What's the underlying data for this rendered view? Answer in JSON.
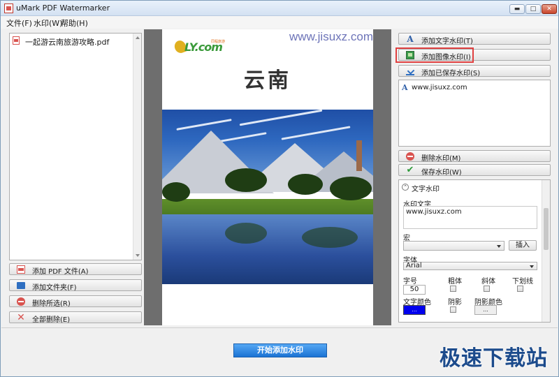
{
  "window": {
    "title": "uMark PDF Watermarker",
    "minimize": "▬",
    "restore": "□",
    "close": "✕"
  },
  "menu": [
    "文件(F)",
    "水印(W)",
    "帮助(H)"
  ],
  "left": {
    "files": [
      "一起游云南旅游攻略.pdf"
    ],
    "buttons": {
      "add_pdf": "添加 PDF 文件(A)",
      "add_folder": "添加文件夹(F)",
      "remove_selected": "删除所选(R)",
      "remove_all": "全部删除(E)"
    }
  },
  "preview": {
    "logo_text": "LY.com",
    "logo_sub": "同程旅游",
    "watermark_text": "www.jisuxz.com",
    "page_title": "云南"
  },
  "right": {
    "buttons": {
      "add_text": "添加文字水印(T)",
      "add_image": "添加图像水印(I)",
      "add_saved": "添加已保存水印(S)",
      "delete": "删除水印(M)",
      "save": "保存水印(W)"
    },
    "watermark_list": [
      "www.jisuxz.com"
    ],
    "props": {
      "section_title": "文字水印",
      "text_label": "水印文字",
      "text_value": "www.jisuxz.com",
      "macro_label": "宏",
      "macro_value": "",
      "insert_btn": "插入",
      "font_label": "字体",
      "font_value": "Arial",
      "size_label": "字号",
      "size_value": "50",
      "bold_label": "粗体",
      "italic_label": "斜体",
      "underline_label": "下划线",
      "color_label": "文字颜色",
      "shadow_label": "阴影",
      "shadow_color_label": "阴影颜色",
      "color_btn": "...",
      "shadow_color_btn": "...",
      "text_color": "#0000ee"
    }
  },
  "footer": {
    "start_btn": "开始添加水印",
    "site_watermark": "极速下载站"
  }
}
